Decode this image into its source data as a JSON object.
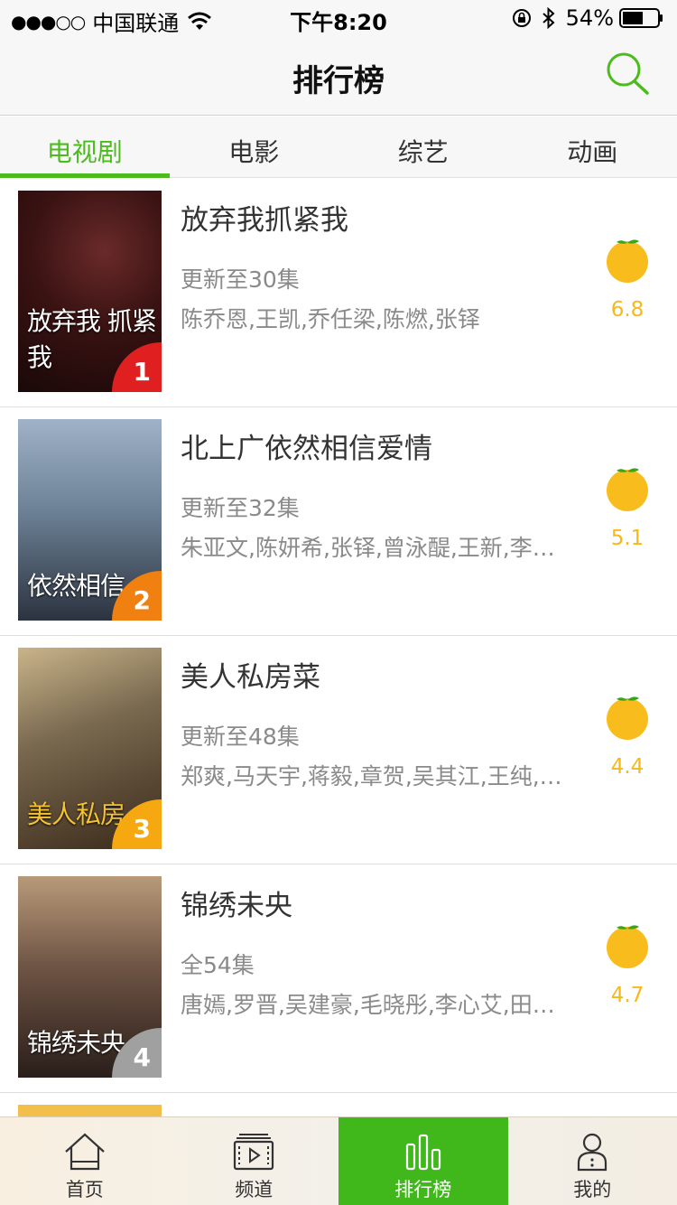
{
  "status_bar": {
    "signal": "●●●○○",
    "carrier": "中国联通",
    "time": "下午8:20",
    "battery": "54%"
  },
  "header": {
    "title": "排行榜"
  },
  "tabs": [
    {
      "label": "电视剧",
      "active": true
    },
    {
      "label": "电影",
      "active": false
    },
    {
      "label": "综艺",
      "active": false
    },
    {
      "label": "动画",
      "active": false
    }
  ],
  "items": [
    {
      "rank": "1",
      "title": "放弃我抓紧我",
      "episodes": "更新至30集",
      "cast": "陈乔恩,王凯,乔任梁,陈燃,张铎",
      "score": "6.8",
      "poster_text": "放弃我 抓紧我",
      "badge_color": "#e02020"
    },
    {
      "rank": "2",
      "title": "北上广依然相信爱情",
      "episodes": "更新至32集",
      "cast": "朱亚文,陈妍希,张铎,曾泳醍,王新,李…",
      "score": "5.1",
      "poster_text": "依然相信",
      "badge_color": "#f08010"
    },
    {
      "rank": "3",
      "title": "美人私房菜",
      "episodes": "更新至48集",
      "cast": "郑爽,马天宇,蒋毅,章贺,吴其江,王纯,…",
      "score": "4.4",
      "poster_text": "美人私房",
      "badge_color": "#f5a810"
    },
    {
      "rank": "4",
      "title": "锦绣未央",
      "episodes": "全54集",
      "cast": "唐嫣,罗晋,吴建豪,毛晓彤,李心艾,田…",
      "score": "4.7",
      "poster_text": "锦绣未央",
      "badge_color": "#a0a0a0"
    }
  ],
  "tab_bar": [
    {
      "label": "首页",
      "icon": "home-icon",
      "active": false
    },
    {
      "label": "频道",
      "icon": "channel-icon",
      "active": false
    },
    {
      "label": "排行榜",
      "icon": "ranking-icon",
      "active": true
    },
    {
      "label": "我的",
      "icon": "profile-icon",
      "active": false
    }
  ],
  "colors": {
    "accent": "#4bbb1d",
    "score": "#f7b819"
  }
}
